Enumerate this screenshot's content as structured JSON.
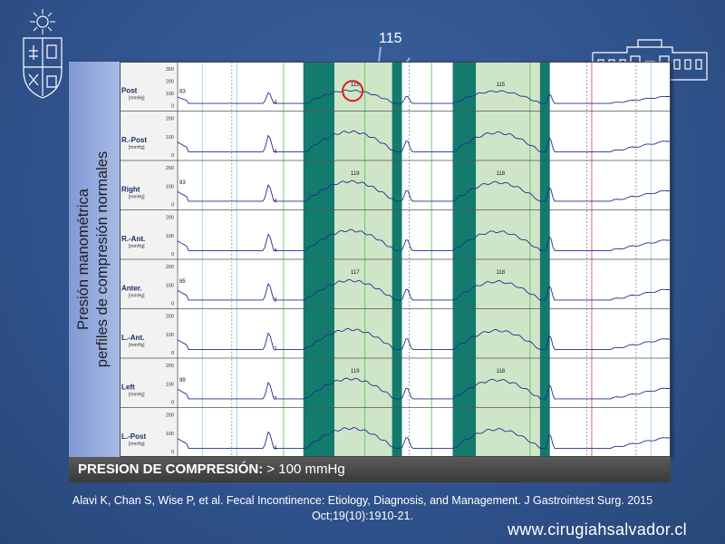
{
  "slide": {
    "callout_value": "115",
    "side_title_line1": "Presión manométrica",
    "side_title_line2": "perfiles de compresión normales",
    "caption_bold": "PRESION DE COMPRESIÓN:",
    "caption_rest": " > 100 mmHg",
    "citation_line1": "Alavi K, Chan S, Wise P, et al. Fecal Incontinence: Etiology, Diagnosis, and Management. J Gastrointest Surg. 2015",
    "citation_line2": "Oct;19(10):1910-21.",
    "website": "www.cirugiahsalvador.cl",
    "logo_left": "university-crest-icon",
    "logo_right": "hospital-building-icon"
  },
  "colors": {
    "background": "#33578e",
    "dark_band": "#137a6e",
    "light_band": "#cfe5c8",
    "trace": "#1f2f8a",
    "circle": "#d02020",
    "callout_line": "#8fb7e4"
  },
  "chart_data": {
    "type": "line",
    "title": "",
    "unit_label": "[mmHg]",
    "y_ticks": [
      "300",
      "200",
      "100",
      "0"
    ],
    "channels": [
      {
        "name": "Post",
        "ticks": [
          "300",
          "200",
          "100",
          "0"
        ],
        "start_value": "83",
        "peak1": "115",
        "peak2": "115",
        "marker": "4"
      },
      {
        "name": "R.-Post",
        "ticks": [
          "200",
          "100",
          "0"
        ],
        "start_value": "",
        "peak1": "",
        "peak2": "",
        "marker": "4"
      },
      {
        "name": "Right",
        "ticks": [
          "200",
          "100",
          "0"
        ],
        "start_value": "93",
        "peak1": "119",
        "peak2": "118",
        "marker": "4"
      },
      {
        "name": "R.-Ant.",
        "ticks": [
          "200",
          "100",
          "0"
        ],
        "start_value": "",
        "peak1": "",
        "peak2": "",
        "marker": "4"
      },
      {
        "name": "Anter.",
        "ticks": [
          "200",
          "100",
          "0"
        ],
        "start_value": "85",
        "peak1": "117",
        "peak2": "118",
        "marker": "3"
      },
      {
        "name": "L.-Ant.",
        "ticks": [
          "200",
          "100",
          "0"
        ],
        "start_value": "",
        "peak1": "",
        "peak2": "",
        "marker": "7"
      },
      {
        "name": "Left",
        "ticks": [
          "200",
          "100",
          "0"
        ],
        "start_value": "99",
        "peak1": "119",
        "peak2": "118",
        "marker": "7"
      },
      {
        "name": "L.-Post",
        "ticks": [
          "200",
          "100",
          "0"
        ],
        "start_value": "",
        "peak1": "",
        "peak2": "",
        "marker": "4"
      }
    ],
    "squeeze_peaks_mmHg": [
      115,
      119,
      117,
      119,
      115,
      118,
      118,
      118
    ]
  }
}
